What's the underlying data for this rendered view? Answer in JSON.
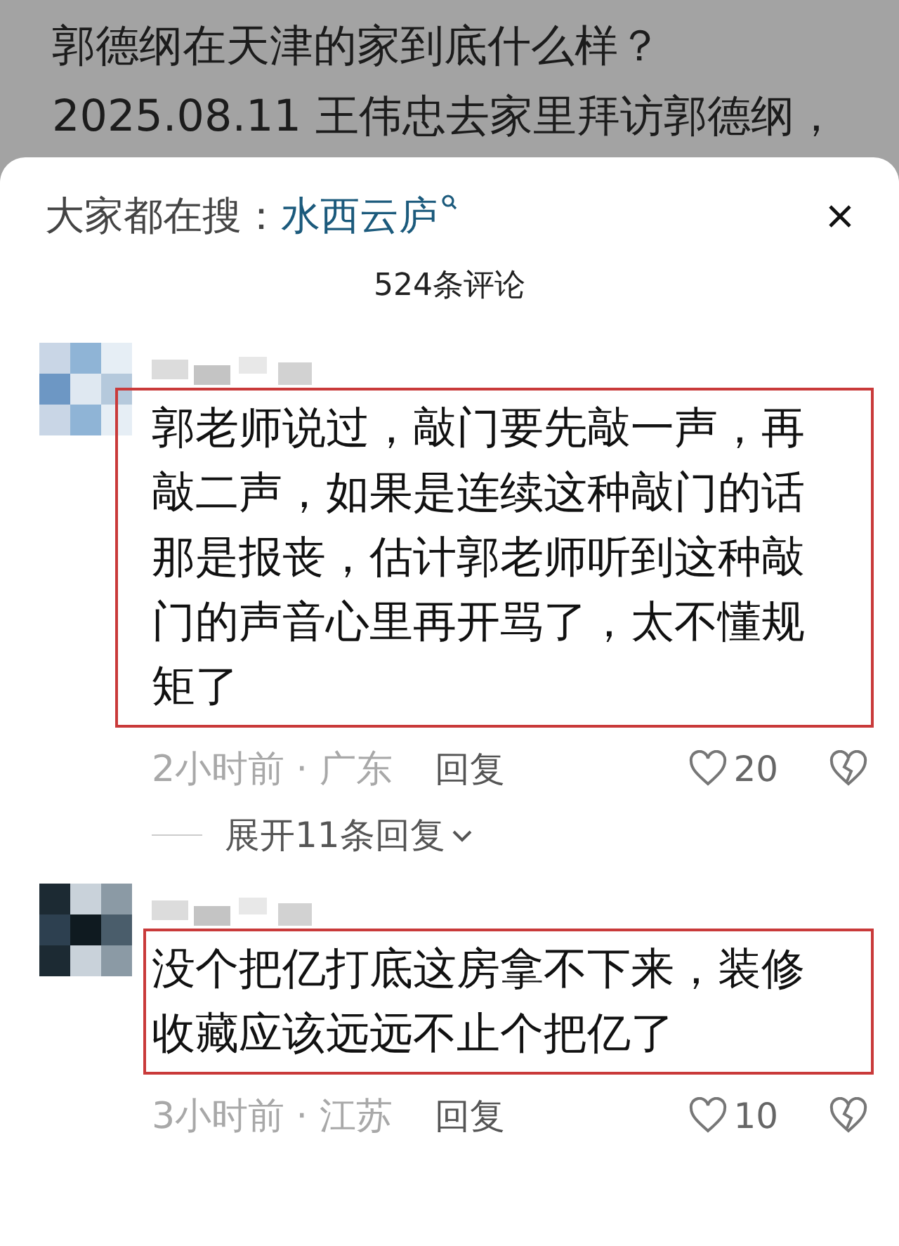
{
  "background_post": {
    "lines": [
      "郭德纲在天津的家到底什么样？",
      "2025.08.11 王伟忠去家里拜访郭德纲，"
    ]
  },
  "sheet": {
    "search_hint": {
      "label": "大家都在搜：",
      "term": "水西云庐"
    },
    "count": "524条评论"
  },
  "comments": [
    {
      "text": "郭老师说过，敲门要先敲一声，再敲二声，如果是连续这种敲门的话那是报丧，估计郭老师听到这种敲门的声音心里再开骂了，太不懂规矩了",
      "highlighted": true,
      "time_location": "2小时前 · 广东",
      "reply": "回复",
      "likes": "20",
      "expand": "展开11条回复"
    },
    {
      "text": "没个把亿打底这房拿不下来，装修收藏应该远远不止个把亿了",
      "highlighted": true,
      "time_location": "3小时前 · 江苏",
      "reply": "回复",
      "likes": "10"
    }
  ]
}
